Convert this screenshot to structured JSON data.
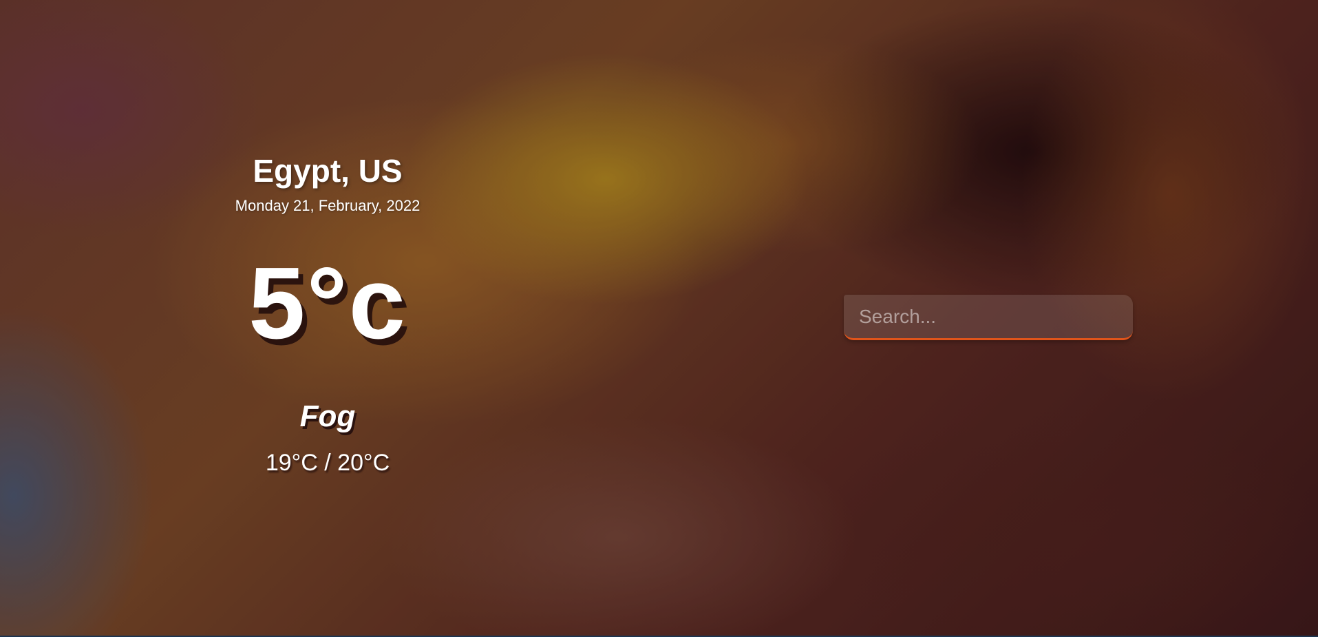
{
  "weather": {
    "location": "Egypt, US",
    "date": "Monday 21, February, 2022",
    "temperature": "5°c",
    "condition": "Fog",
    "range": "19°C / 20°C"
  },
  "search": {
    "placeholder": "Search...",
    "value": ""
  },
  "colors": {
    "search_underline": "#e0541a",
    "text": "#ffffff"
  }
}
